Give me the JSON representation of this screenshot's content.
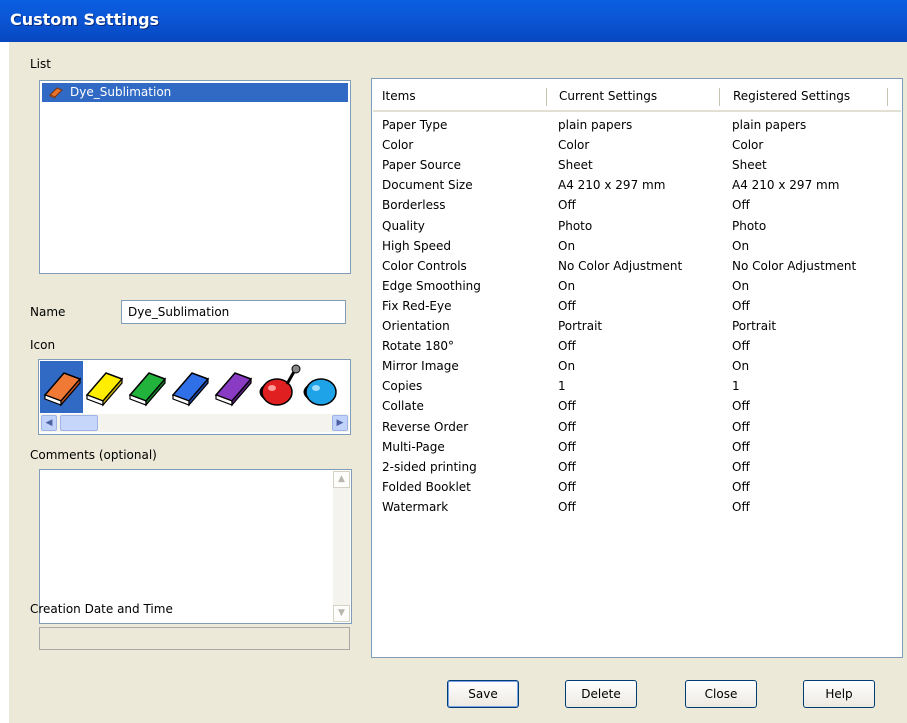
{
  "window": {
    "title": "Custom Settings"
  },
  "list": {
    "label": "List",
    "items": [
      {
        "label": "Dye_Sublimation",
        "icon": "orange-book-icon"
      }
    ]
  },
  "name": {
    "label": "Name",
    "value": "Dye_Sublimation"
  },
  "icon": {
    "label": "Icon",
    "options": [
      "orange-book-icon",
      "yellow-book-icon",
      "green-book-icon",
      "blue-book-icon",
      "purple-book-icon",
      "red-watering-can-icon",
      "blue-watering-can-icon"
    ],
    "selected": "orange-book-icon"
  },
  "comments": {
    "label": "Comments (optional)",
    "value": ""
  },
  "creation": {
    "label": "Creation Date and Time",
    "value": ""
  },
  "settings_table": {
    "headers": [
      "Items",
      "Current Settings",
      "Registered Settings"
    ],
    "rows": [
      [
        "Paper Type",
        "plain papers",
        "plain papers"
      ],
      [
        "Color",
        "Color",
        "Color"
      ],
      [
        "Paper Source",
        "Sheet",
        "Sheet"
      ],
      [
        "Document Size",
        "A4 210 x 297 mm",
        "A4 210 x 297 mm"
      ],
      [
        "Borderless",
        "Off",
        "Off"
      ],
      [
        "Quality",
        "Photo",
        "Photo"
      ],
      [
        "High Speed",
        "On",
        "On"
      ],
      [
        "Color Controls",
        "No Color Adjustment",
        "No Color Adjustment"
      ],
      [
        "Edge Smoothing",
        "On",
        "On"
      ],
      [
        "Fix Red-Eye",
        "Off",
        "Off"
      ],
      [
        "Orientation",
        "Portrait",
        "Portrait"
      ],
      [
        "Rotate 180°",
        "Off",
        "Off"
      ],
      [
        "Mirror Image",
        "On",
        "On"
      ],
      [
        "Copies",
        "1",
        "1"
      ],
      [
        "Collate",
        "Off",
        "Off"
      ],
      [
        "Reverse Order",
        "Off",
        "Off"
      ],
      [
        "Multi-Page",
        "Off",
        "Off"
      ],
      [
        "2-sided printing",
        "Off",
        "Off"
      ],
      [
        "Folded Booklet",
        "Off",
        "Off"
      ],
      [
        "Watermark",
        "Off",
        "Off"
      ]
    ]
  },
  "buttons": {
    "save": "Save",
    "delete": "Delete",
    "close": "Close",
    "help": "Help"
  },
  "colors": {
    "titlebar": "#0b57d7",
    "selection": "#316ac5",
    "dialog_bg": "#ece9d8",
    "border": "#7f9db9"
  }
}
